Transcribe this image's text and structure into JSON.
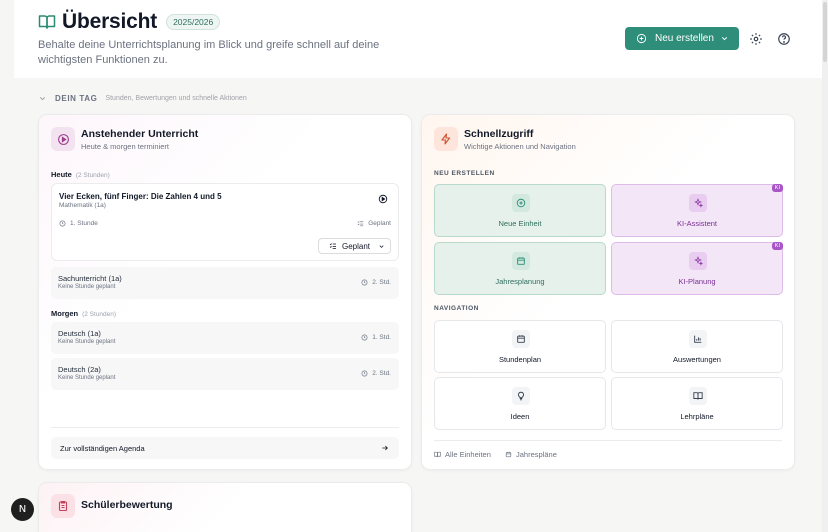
{
  "header": {
    "title": "Übersicht",
    "year": "2025/2026",
    "subtitle": "Behalte deine Unterrichtsplanung im Blick und greife schnell auf deine wichtigsten Funktionen zu.",
    "new_button": "Neu erstellen"
  },
  "section": {
    "title": "DEIN TAG",
    "subtitle": "Stunden, Bewertungen und schnelle Aktionen"
  },
  "upcoming": {
    "title": "Anstehender Unterricht",
    "subtitle": "Heute & morgen terminiert",
    "today_label": "Heute",
    "today_count": "(2 Stunden)",
    "main_lesson": {
      "title": "Vier Ecken, fünf Finger: Die Zahlen 4 und 5",
      "subject": "Mathematik (1a)",
      "period": "1. Stunde",
      "status": "Geplant",
      "select_value": "Geplant"
    },
    "today_rows": [
      {
        "title": "Sachunterricht (1a)",
        "note": "Keine Stunde geplant",
        "time": "2. Std."
      }
    ],
    "tomorrow_label": "Morgen",
    "tomorrow_count": "(2 Stunden)",
    "tomorrow_rows": [
      {
        "title": "Deutsch (1a)",
        "note": "Keine Stunde geplant",
        "time": "1. Std."
      },
      {
        "title": "Deutsch (2a)",
        "note": "Keine Stunde geplant",
        "time": "2. Std."
      }
    ],
    "agenda_link": "Zur vollständigen Agenda"
  },
  "quick": {
    "title": "Schnellzugriff",
    "subtitle": "Wichtige Aktionen und Navigation",
    "create_label": "NEU ERSTELLEN",
    "create_tiles": [
      {
        "label": "Neue Einheit",
        "icon": "plus-circle-icon"
      },
      {
        "label": "KI-Assistent",
        "icon": "sparkles-icon",
        "badge": "KI"
      },
      {
        "label": "Jahresplanung",
        "icon": "calendar-icon"
      },
      {
        "label": "KI-Planung",
        "icon": "sparkles-icon",
        "badge": "KI"
      }
    ],
    "nav_label": "NAVIGATION",
    "nav_tiles": [
      {
        "label": "Stundenplan",
        "icon": "calendar-icon"
      },
      {
        "label": "Auswertungen",
        "icon": "bar-chart-icon"
      },
      {
        "label": "Ideen",
        "icon": "lightbulb-icon"
      },
      {
        "label": "Lehrpläne",
        "icon": "book-open-icon"
      }
    ],
    "footer_links": [
      "Alle Einheiten",
      "Jahrespläne"
    ]
  },
  "grading": {
    "title": "Schülerbewertung"
  },
  "avatar_letter": "N",
  "colors": {
    "primary": "#2f8e7a",
    "ai": "#a855c7",
    "background": "#f6f6f5"
  }
}
